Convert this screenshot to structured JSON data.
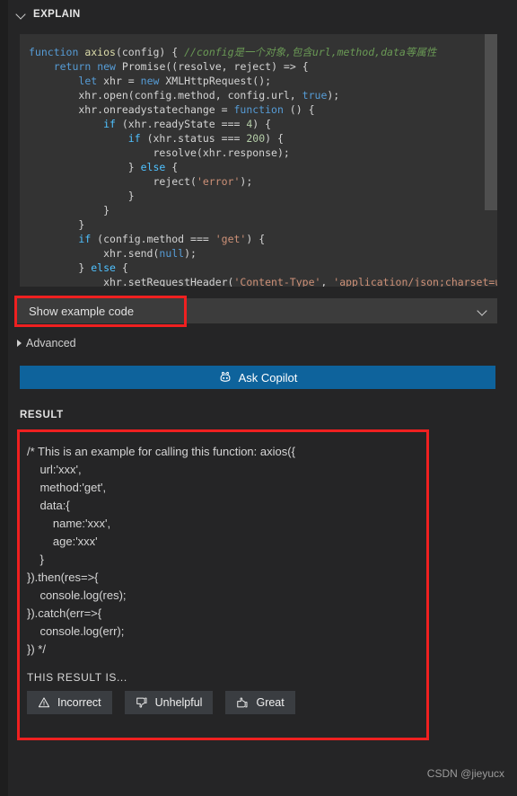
{
  "panel": {
    "section_title": "EXPLAIN",
    "collapse_icon": "chevron-down-icon"
  },
  "code_block": {
    "language": "javascript",
    "lines": [
      "function axios(config) { //config是一个对象,包含url,method,data等属性",
      "    return new Promise((resolve, reject) => {",
      "        let xhr = new XMLHttpRequest();",
      "        xhr.open(config.method, config.url, true);",
      "        xhr.onreadystatechange = function () {",
      "            if (xhr.readyState === 4) {",
      "                if (xhr.status === 200) {",
      "                    resolve(xhr.response);",
      "                } else {",
      "                    reject('error');",
      "                }",
      "            }",
      "        }",
      "        if (config.method === 'get') {",
      "            xhr.send(null);",
      "        } else {",
      "            xhr.setRequestHeader('Content-Type', 'application/json;charset=u"
    ]
  },
  "example_select": {
    "value": "Show example code",
    "chevron_icon": "chevron-down-icon",
    "highlighted": true,
    "highlight_color": "#ef2020"
  },
  "advanced": {
    "label": "Advanced",
    "expand_icon": "triangle-right-icon",
    "expanded": false
  },
  "ask_copilot": {
    "label": "Ask Copilot",
    "icon": "copilot-icon",
    "background": "#0e639c"
  },
  "result": {
    "label": "RESULT",
    "highlight_color": "#ef2020",
    "text": "/* This is an example for calling this function: axios({\n    url:'xxx',\n    method:'get',\n    data:{\n        name:'xxx',\n        age:'xxx'\n    }\n}).then(res=>{\n    console.log(res);\n}).catch(err=>{\n    console.log(err);\n}) */",
    "feedback_prompt": "THIS RESULT IS...",
    "feedback_buttons": [
      {
        "label": "Incorrect",
        "icon": "warning-triangle-icon"
      },
      {
        "label": "Unhelpful",
        "icon": "thumbs-down-icon"
      },
      {
        "label": "Great",
        "icon": "thumbs-up-icon"
      }
    ]
  },
  "watermark": {
    "text": "CSDN @jieyucx"
  }
}
